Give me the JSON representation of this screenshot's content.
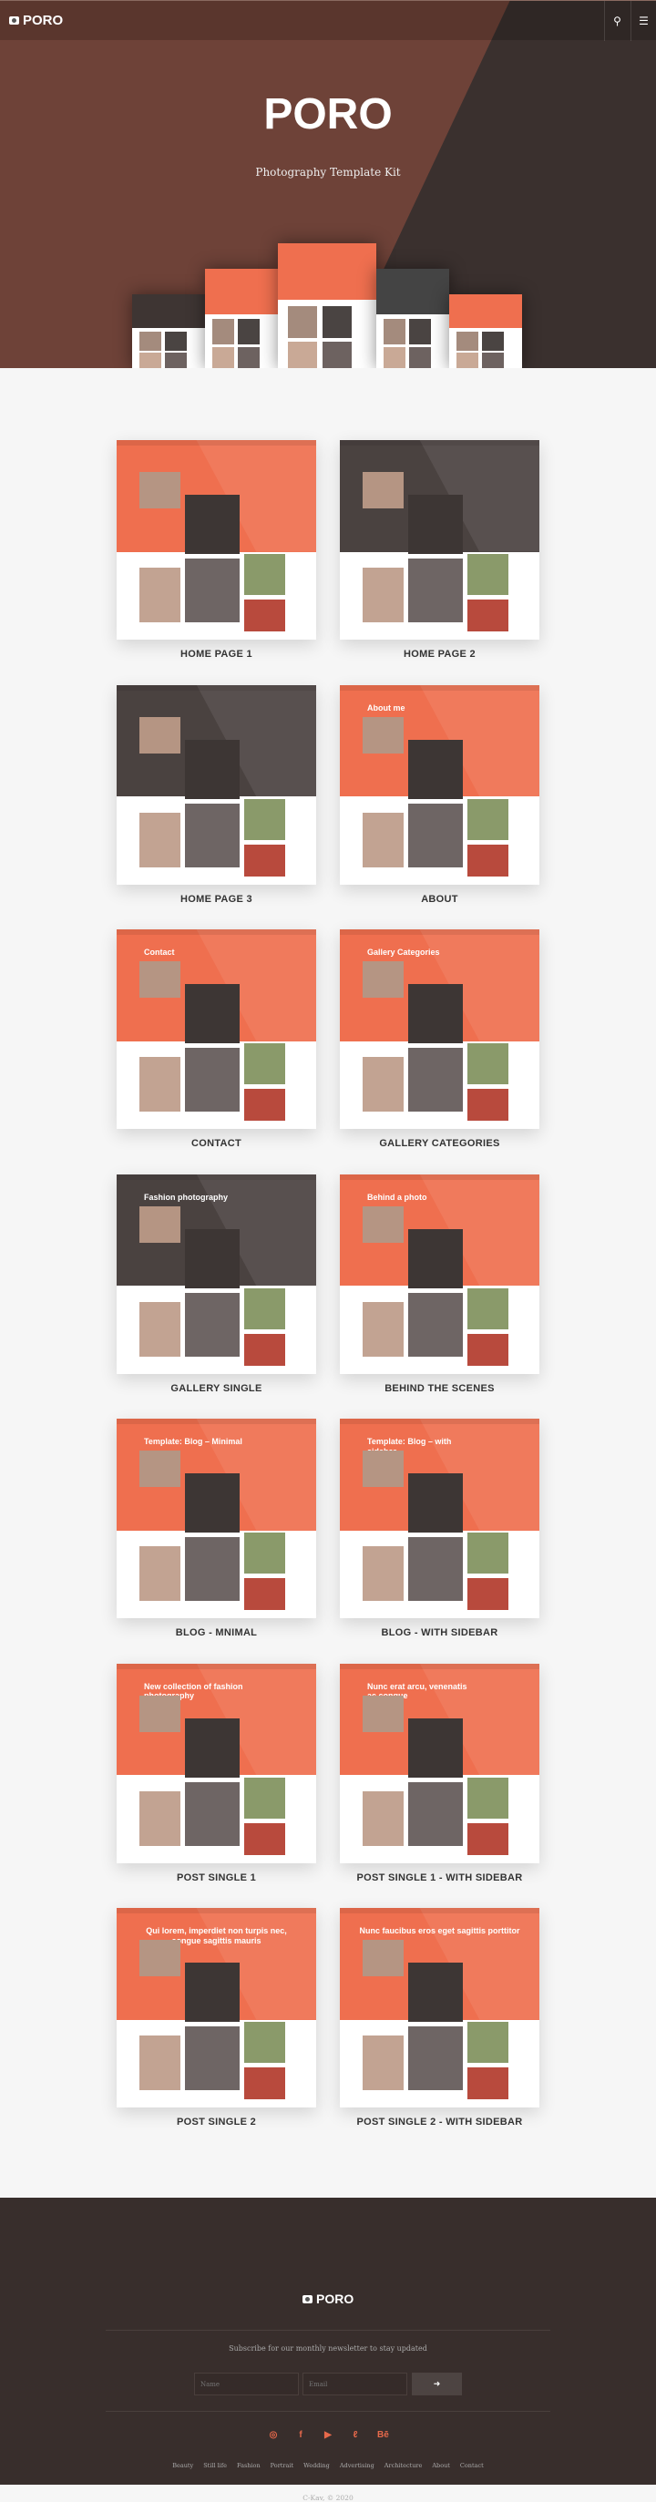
{
  "colors": {
    "accent": "#ef6f4f",
    "hero_left": "#6e4238",
    "hero_right": "#3a302e",
    "dark_header": "#4a4240",
    "footer": "#382e2c"
  },
  "nav": {
    "logo": "PORO",
    "logo_icon": "camera-icon",
    "search_icon": "search-icon",
    "menu_icon": "hamburger-menu-icon"
  },
  "hero": {
    "title": "PORO",
    "subtitle": "Photography Template Kit"
  },
  "demos": [
    {
      "label": "HOME PAGE 1",
      "header": "accent",
      "title": ""
    },
    {
      "label": "HOME PAGE 2",
      "header": "dark",
      "title": ""
    },
    {
      "label": "HOME PAGE 3",
      "header": "dark",
      "title": ""
    },
    {
      "label": "ABOUT",
      "header": "accent",
      "title": "About me"
    },
    {
      "label": "CONTACT",
      "header": "accent",
      "title": "Contact"
    },
    {
      "label": "GALLERY CATEGORIES",
      "header": "accent",
      "title": "Gallery Categories"
    },
    {
      "label": "GALLERY SINGLE",
      "header": "dark",
      "title": "Fashion photography"
    },
    {
      "label": "BEHIND THE SCENES",
      "header": "accent",
      "title": "Behind a photo"
    },
    {
      "label": "BLOG - MNIMAL",
      "header": "accent",
      "title": "Template: Blog – Minimal"
    },
    {
      "label": "BLOG - WITH SIDEBAR",
      "header": "accent",
      "title": "Template: Blog – with sidebar"
    },
    {
      "label": "POST SINGLE 1",
      "header": "accent",
      "title": "New collection of fashion photography"
    },
    {
      "label": "POST SINGLE 1 - WITH SIDEBAR",
      "header": "accent",
      "title": "Nunc erat arcu, venenatis ac congue"
    },
    {
      "label": "POST SINGLE 2",
      "header": "accent",
      "title": "Qui lorem, imperdiet non turpis nec, congue sagittis mauris"
    },
    {
      "label": "POST SINGLE 2 - WITH SIDEBAR",
      "header": "accent",
      "title": "Nunc faucibus eros eget sagittis porttitor"
    }
  ],
  "footer": {
    "logo": "PORO",
    "newsletter_text": "Subscribe for our monthly newsletter to stay updated",
    "name_placeholder": "Name",
    "email_placeholder": "Email",
    "submit_icon": "arrow-right-icon",
    "socials": [
      "instagram-icon",
      "facebook-icon",
      "youtube-icon",
      "500px-icon",
      "behance-icon"
    ],
    "links": [
      "Beauty",
      "Still life",
      "Fashion",
      "Portrait",
      "Wedding",
      "Advertising",
      "Architecture",
      "About",
      "Contact"
    ],
    "copyright": "C-Kav, © 2020"
  }
}
